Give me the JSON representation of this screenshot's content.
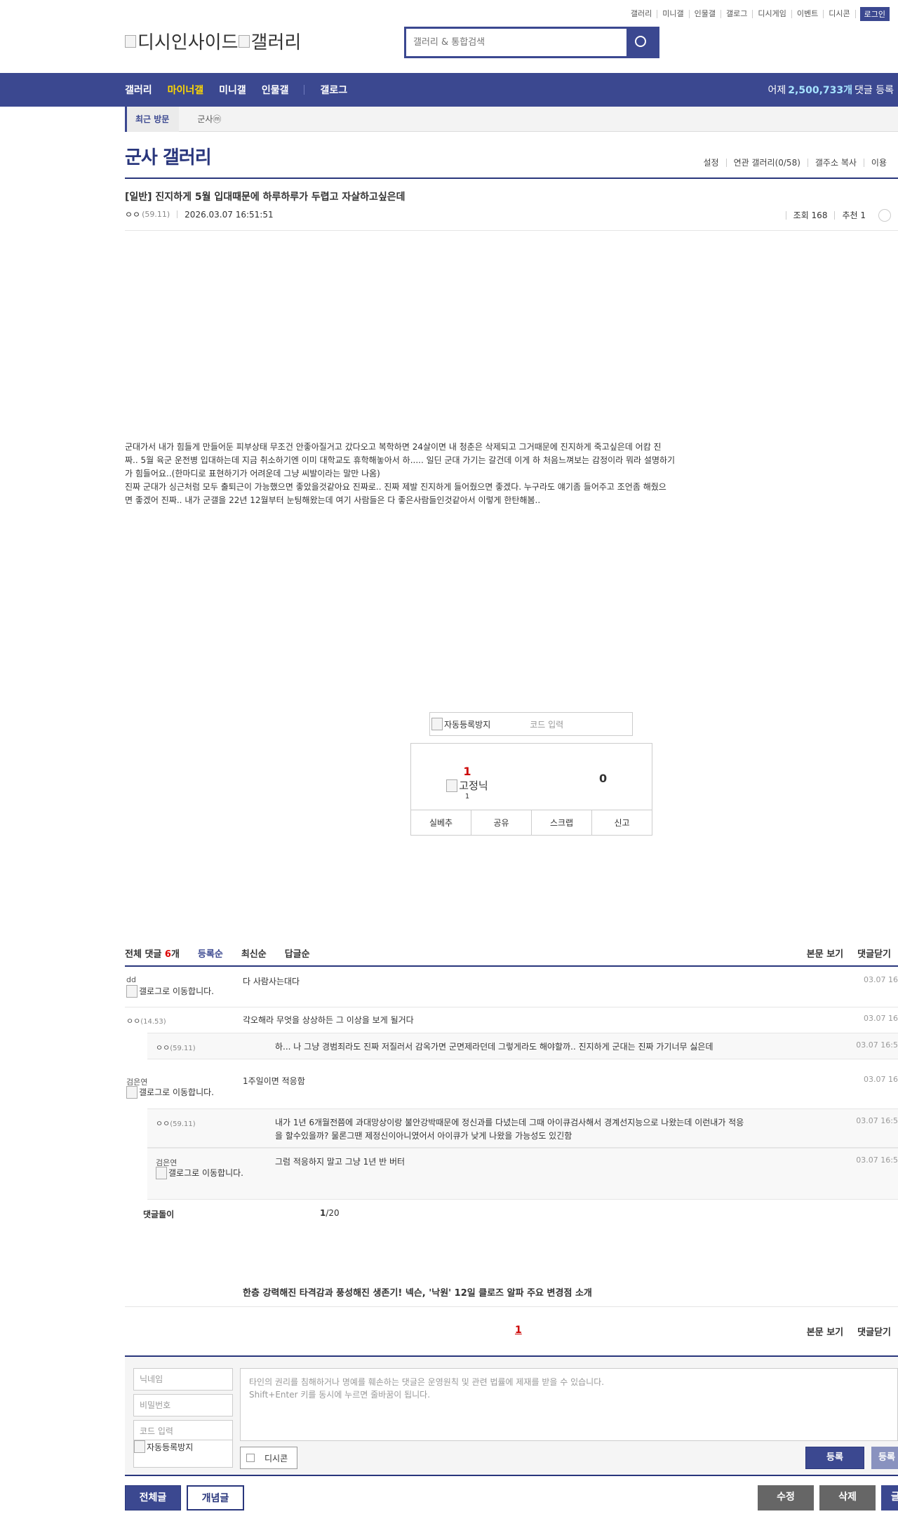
{
  "util_menu": [
    "갤러리",
    "미니갤",
    "인물갤",
    "갤로그",
    "디시게임",
    "이벤트",
    "디시콘"
  ],
  "login_label": "로그인",
  "logo": {
    "part1": "디시인사이드",
    "part2": "갤러리"
  },
  "search": {
    "placeholder": "갤러리 & 통합검색"
  },
  "gnb": {
    "items": [
      "갤러리",
      "마이너갤",
      "미니갤",
      "인물갤",
      "갤로그"
    ],
    "active": "마이너갤",
    "stat_prefix": "어제",
    "stat_value": "2,500,733개",
    "stat_suffix": "댓글 등록"
  },
  "recent_visit": {
    "label": "최근 방문",
    "gallery": "군사ⓜ"
  },
  "gallery_title": "군사 갤러리",
  "gallery_tools": [
    "설정",
    "연관 갤러리(0/58)",
    "갤주소 복사",
    "이용"
  ],
  "post": {
    "title": "[일반] 진지하게 5월 입대때문에 하루하루가 두렵고 자살하고싶은데",
    "author": "ㅇㅇ",
    "author_ip": "(59.11)",
    "date": "2026.03.07 16:51:51",
    "views": "조회 168",
    "recommend": "추천 1",
    "body": [
      "군대가서 내가 힘들게 만들어둔 피부상태 무조건 안좋아질거고 갔다오고 복학하면 24살이면 내 청춘은 삭제되고 그거때문에 진지하게 죽고싶은데 어캄 진",
      "짜.. 5월 육군 운전병 입대하는데 지금 취소하기엔 이미 대학교도 휴학해놓아서 하..... 일딘 군대 가기는 갈건데 이게 하 처음느껴보는 감정이라 뭐라 설명하기",
      "가 힘들어요..(한마디로 표현하기가 어려운데 그냥 씨발이라는 말만 나옴)",
      "진짜 군대가 싱근처럼 모두 출퇴근이 가능했으면 좋았을것같아요 진짜로.. 진짜 제발 진지하게 들어줬으면 좋겠다. 누구라도 얘기좀 들어주고 조언좀 해줬으",
      "면 좋겠어 진짜.. 내가 군갤을 22년 12월부터 눈팅해왔는데 여기 사람들은 다 좋은사람들인것같아서 이렇게 한탄해봄.."
    ]
  },
  "captcha": {
    "img_alt": "자동등록방지",
    "placeholder": "코드 입력"
  },
  "recommend_box": {
    "up_count": "1",
    "fixed_alt": "고정닉",
    "fixed_count": "1",
    "down_count": "0",
    "actions": [
      "실베추",
      "공유",
      "스크랩",
      "신고"
    ]
  },
  "comments_header": {
    "label": "전체 댓글",
    "count": "6",
    "unit": "개",
    "sorts": [
      "등록순",
      "최신순",
      "답글순"
    ],
    "right": [
      "본문 보기",
      "댓글닫기"
    ]
  },
  "comments": [
    {
      "nick": "dd",
      "ip": "",
      "gallog": "갤로그로 이동합니다.",
      "text": "다 사람사는대다",
      "date": "03.07 16"
    },
    {
      "nick": "ㅇㅇ",
      "ip": "(14.53)",
      "gallog": "",
      "text": "각오해라 무엇을 상상하든 그 이상을 보게 될거다",
      "date": "03.07 16"
    },
    {
      "nick": "ㅇㅇ",
      "ip": "(59.11)",
      "gallog": "",
      "text": "하... 나 그냥 경범죄라도 진짜 저질러서 감옥가면 군면제라던데 그렇게라도 해야할까.. 진지하게 군대는 진짜 가기너무 싫은데",
      "date": "03.07 16:5"
    },
    {
      "nick": "검은연",
      "ip": "",
      "gallog": "갤로그로 이동합니다.",
      "text": "1주일이면 적응함",
      "date": "03.07 16"
    },
    {
      "nick": "ㅇㅇ",
      "ip": "(59.11)",
      "gallog": "",
      "text": "내가 1년 6개월전쯤에 과대망상이랑 불안강박때문에 정신과를 다녔는데 그때 아이큐검사해서 경계선지능으로 나왔는데 이런내가 적응",
      "text2": "을 할수있을까? 물론그땐 제정신이아니였어서 아이큐가 낮게 나왔을 가능성도 있긴함",
      "date": "03.07 16:5"
    },
    {
      "nick": "검은연",
      "ip": "",
      "gallog": "갤로그로 이동합니다.",
      "text": "그럼 적응하지 말고 그냥 1년 반 버터",
      "date": "03.07 16:5"
    }
  ],
  "comment_footer": {
    "label": "댓글돌이",
    "page_current": "1",
    "page_total": "/20"
  },
  "news_headline": "한층 강력해진 타격감과 풍성해진 생존기! 넥슨, '낙원' 12일 클로즈 알파 주요 변경점 소개",
  "bottom_page": "1",
  "bottom_right": [
    "본문 보기",
    "댓글닫기"
  ],
  "write": {
    "nick_placeholder": "닉네임",
    "pw_placeholder": "비밀번호",
    "code_placeholder": "코드 입력",
    "captcha_alt": "자동등록방지",
    "textarea_placeholder_1": "타인의 권리를 침해하거나 명예를 훼손하는 댓글은 운영원칙 및 관련 법률에 제재를 받을 수 있습니다.",
    "textarea_placeholder_2": "Shift+Enter 키를 동시에 누르면 줄바꿈이 됩니다.",
    "dccon_label": "디시콘",
    "submit_label": "등록",
    "submit2_label": "등록"
  },
  "bottom_buttons": {
    "all": "전체글",
    "concept": "개념글",
    "edit": "수정",
    "delete": "삭제",
    "write": "글"
  }
}
